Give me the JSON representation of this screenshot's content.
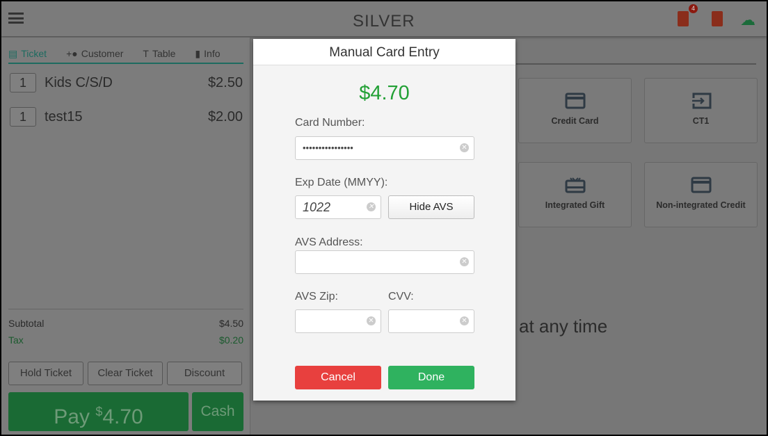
{
  "header": {
    "logo": "SILVER",
    "notification_count": "4"
  },
  "tabs": [
    {
      "label": "Ticket"
    },
    {
      "label": "Customer"
    },
    {
      "label": "Table"
    },
    {
      "label": "Info"
    }
  ],
  "ticket_items": [
    {
      "qty": "1",
      "name": "Kids C/S/D",
      "price": "$2.50"
    },
    {
      "qty": "1",
      "name": "test15",
      "price": "$2.00"
    }
  ],
  "totals": {
    "subtotal_label": "Subtotal",
    "subtotal": "$4.50",
    "tax_label": "Tax",
    "tax": "$0.20"
  },
  "actions": {
    "hold": "Hold Ticket",
    "clear": "Clear Ticket",
    "discount": "Discount",
    "pay_label": "Pay",
    "pay_currency": "$",
    "pay_amount": "4.70",
    "cash": "Cash"
  },
  "payment_tiles": [
    {
      "label": "Credit Card",
      "icon": "credit-card-icon"
    },
    {
      "label": "CT1",
      "icon": "card-reader-icon"
    },
    {
      "label": "Integrated Gift",
      "icon": "gift-card-icon"
    },
    {
      "label": "Non-integrated Credit",
      "icon": "credit-card-icon"
    }
  ],
  "background_text": "at any time",
  "modal": {
    "title": "Manual Card Entry",
    "amount": "$4.70",
    "card_number_label": "Card Number:",
    "card_number_value": "••••••••••••••••",
    "exp_label": "Exp Date (MMYY):",
    "exp_value": "1022",
    "hide_avs": "Hide AVS",
    "avs_address_label": "AVS Address:",
    "avs_address_value": "",
    "avs_zip_label": "AVS Zip:",
    "avs_zip_value": "",
    "cvv_label": "CVV:",
    "cvv_value": "",
    "cancel": "Cancel",
    "done": "Done"
  },
  "colors": {
    "accent": "#22a035",
    "cancel": "#e8403e",
    "done": "#2fb25f"
  }
}
